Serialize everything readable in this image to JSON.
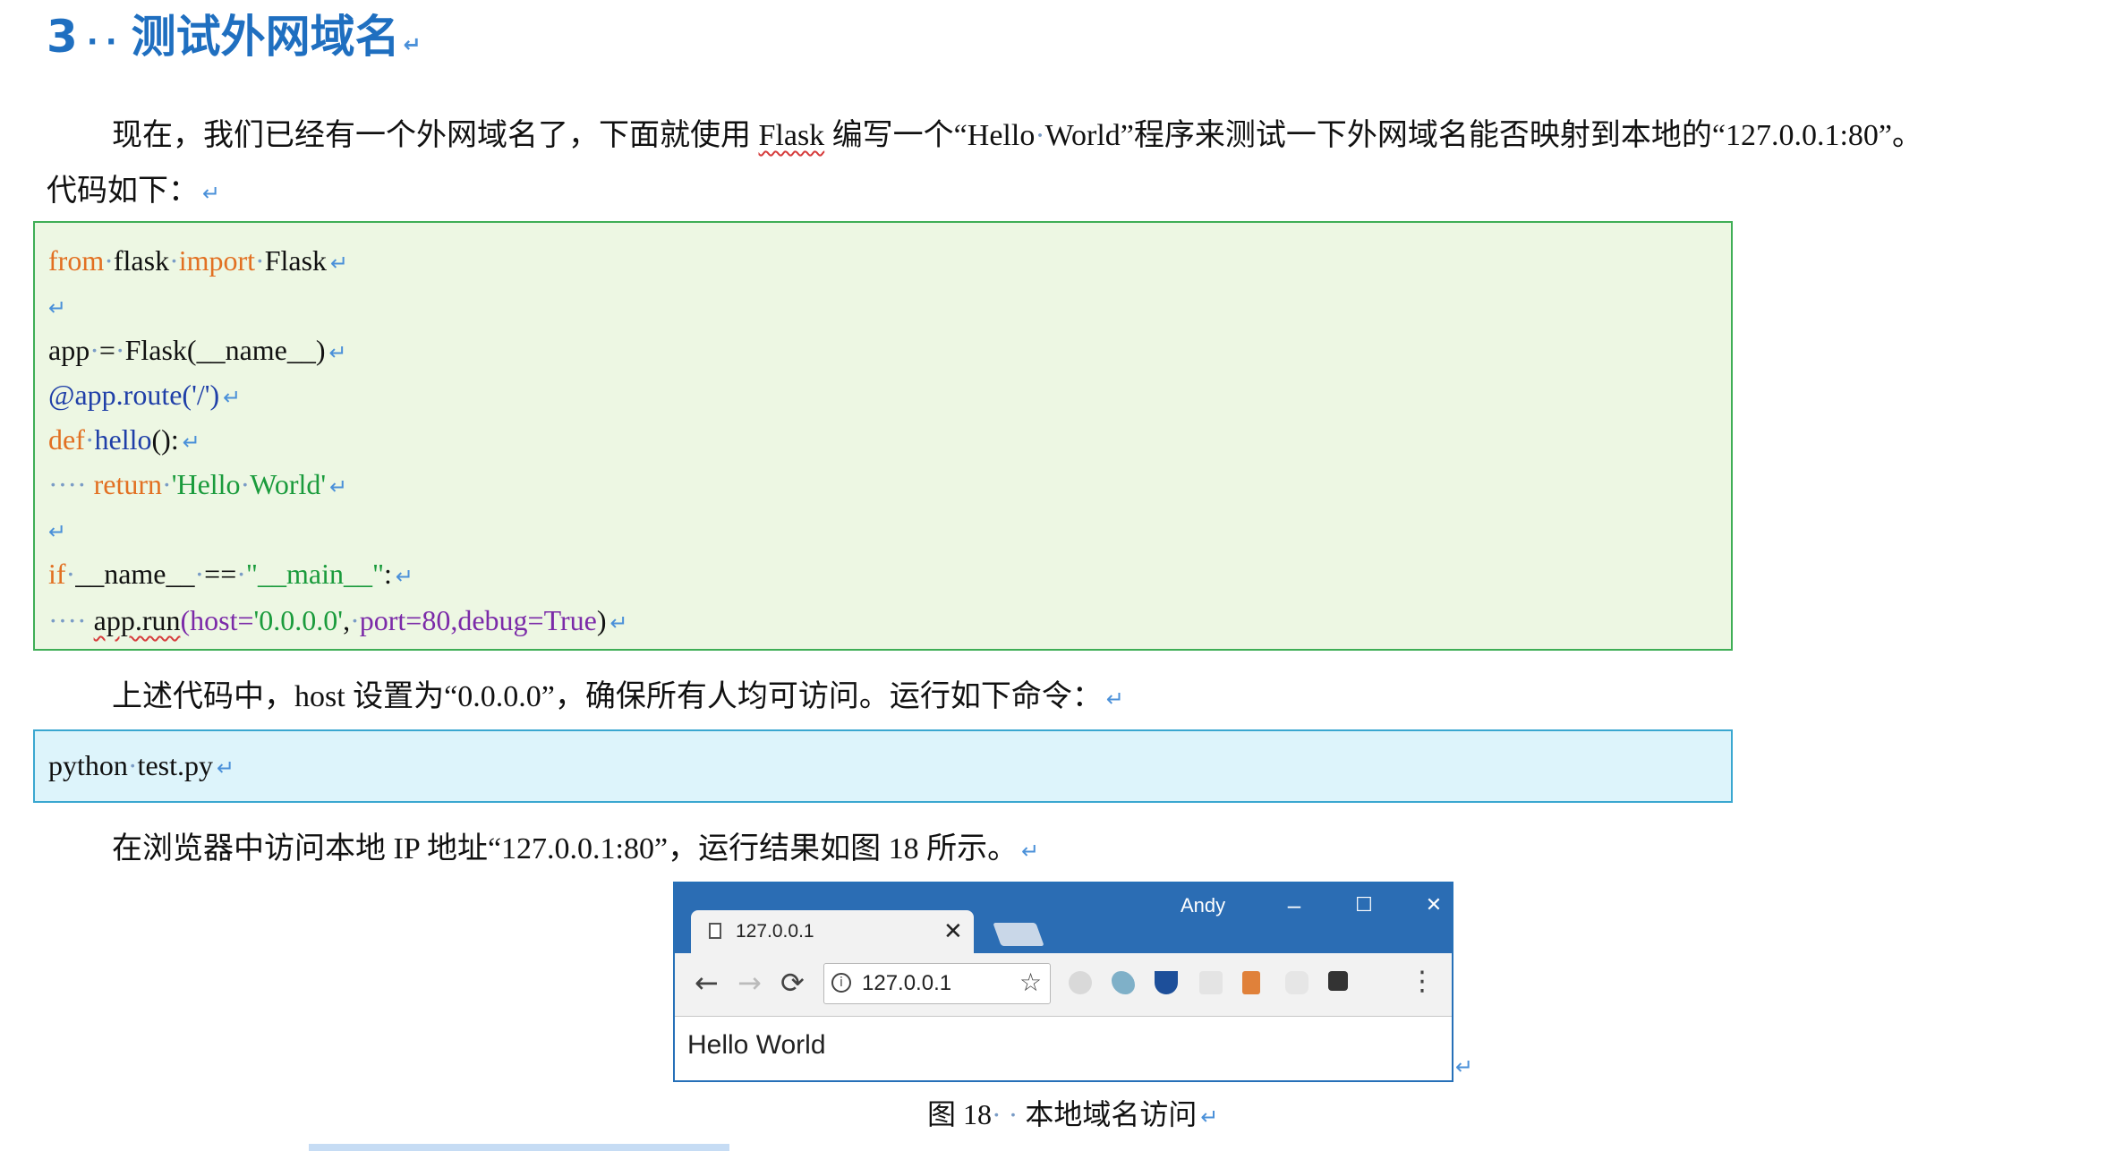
{
  "heading": {
    "number": "3",
    "title": "测试外网域名"
  },
  "paragraphs": {
    "intro_line1_a": "现在，我们已经有一个外网域名了，下面就使用",
    "intro_line1_flask": "Flask",
    "intro_line1_b": "编写一个“Hello",
    "intro_line1_c": "World”程序来测试一下外网域名能否映射到本地的“127.0.0.1:80”。",
    "intro_line2": "代码如下：",
    "host_note": "上述代码中，host 设置为“0.0.0.0”，确保所有人均可访问。运行如下命令：",
    "browser_note": "在浏览器中访问本地 IP 地址“127.0.0.1:80”，运行结果如图 18 所示。"
  },
  "code": {
    "kw_from": "from",
    "mod_flask": "flask",
    "kw_import": "import",
    "cls_flask": "Flask",
    "l3_app": "app",
    "l3_eq": "=",
    "l3_call": "Flask(__name__)",
    "l4_decorator": "@app.route('/')",
    "kw_def": "def",
    "l5_fn": "hello",
    "l5_rest": "():",
    "kw_return": "return",
    "l6_str_a": "'Hello",
    "l6_str_b": "World'",
    "kw_if": "if",
    "l8_name": "__name__",
    "l8_eq": "==",
    "l8_str": "\"__main__\"",
    "l8_colon": ":",
    "l9_call": "app.run",
    "l9_open": "(",
    "l9_host": "host=",
    "l9_host_val": "'0.0.0.0'",
    "l9_comma": ",",
    "l9_port": "port=80,",
    "l9_debug": "debug=True",
    "l9_close": ")"
  },
  "command": {
    "a": "python",
    "b": "test.py"
  },
  "browser": {
    "user": "Andy",
    "minimize": "–",
    "maximize": "☐",
    "close": "✕",
    "tab_title": "127.0.0.1",
    "tab_close": "✕",
    "back": "←",
    "forward": "→",
    "reload": "⟳",
    "info": "i",
    "url": "127.0.0.1",
    "star": "☆",
    "menu": "⋮",
    "page_text": "Hello World",
    "extension_icons": [
      "gray-ball-icon",
      "bird-icon",
      "v-shield-icon",
      "a-icon",
      "pilcrow-icon",
      "fox-mask-icon",
      "x-box-icon"
    ]
  },
  "caption": {
    "label": "图 18",
    "text": "本地域名访问"
  }
}
